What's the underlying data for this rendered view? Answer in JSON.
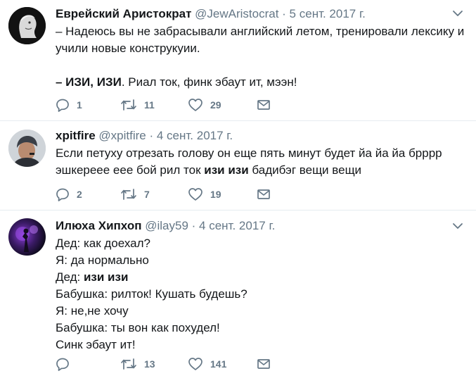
{
  "tweets": [
    {
      "name": "Еврейский Аристократ",
      "handle": "@JewAristocrat",
      "date": "· 5 сент. 2017 г.",
      "lines": [
        "– Надеюсь вы не забрасывали английский летом, тренировали лексику и",
        "учили новые конструкуии."
      ],
      "line3_bold": "– ИЗИ, ИЗИ",
      "line3_rest": ". Риал ток, финк эбаут ит, мээн!",
      "replies": "1",
      "retweets": "11",
      "likes": "29"
    },
    {
      "name": "xpitfire",
      "handle": "@xpitfire",
      "date": "· 4 сент. 2017 г.",
      "line1": "Если петуху отрезать голову он еще пять минут будет йа йа йа брррр",
      "line2_pre": "эшкерееe еее бой рил ток ",
      "line2_bold": "изи изи",
      "line2_post": " бадибэг вещи вещи",
      "replies": "2",
      "retweets": "7",
      "likes": "19"
    },
    {
      "name": "Илюха Хипхоп",
      "handle": "@ilay59",
      "date": "· 4 сент. 2017 г.",
      "l1": "Дед: как доехал?",
      "l2": "Я: да нормально",
      "l3_pre": "Дед: ",
      "l3_bold": "изи изи",
      "l4": "Бабушка: рилток! Кушать будешь?",
      "l5": "Я: не,не хочу",
      "l6": "Бабушка: ты вон как похудел!",
      "l7": "Синк эбаут ит!",
      "replies": "",
      "retweets": "13",
      "likes": "141"
    }
  ],
  "icons": [
    "reply-icon",
    "retweet-icon",
    "like-icon",
    "message-icon",
    "caret-down-icon"
  ],
  "colors": {
    "text": "#14171a",
    "secondary": "#657786",
    "divider": "#e6ecf0"
  }
}
